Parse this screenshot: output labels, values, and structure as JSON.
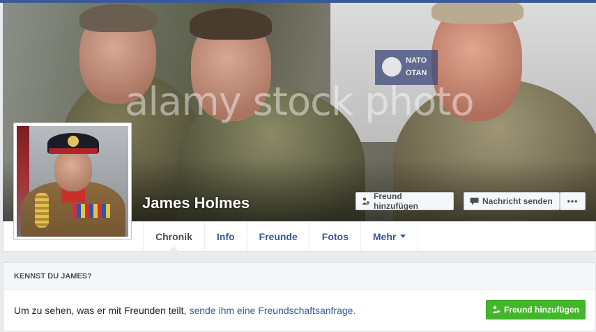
{
  "profile": {
    "name": "James Holmes"
  },
  "cover": {
    "watermark": "alamy stock photo",
    "sign_line1": "NATO",
    "sign_line2": "OTAN",
    "buttons": {
      "add_friend": "Freund hinzufügen",
      "send_message": "Nachricht senden",
      "more": "•••"
    }
  },
  "nav": {
    "tabs": [
      {
        "label": "Chronik"
      },
      {
        "label": "Info"
      },
      {
        "label": "Freunde"
      },
      {
        "label": "Fotos"
      },
      {
        "label": "Mehr"
      }
    ]
  },
  "know_card": {
    "header": "KENNST DU JAMES?",
    "text": "Um zu sehen, was er mit Freunden teilt,",
    "link": "sende ihm eine Freundschaftsanfrage.",
    "button": "Freund hinzufügen"
  },
  "colors": {
    "brand": "#3b5998",
    "link": "#365899",
    "green_button": "#42b72a"
  },
  "icons": {
    "add_friend": "person-plus-icon",
    "message": "chat-bubble-icon",
    "more": "ellipsis-icon",
    "dropdown": "caret-down-icon"
  }
}
